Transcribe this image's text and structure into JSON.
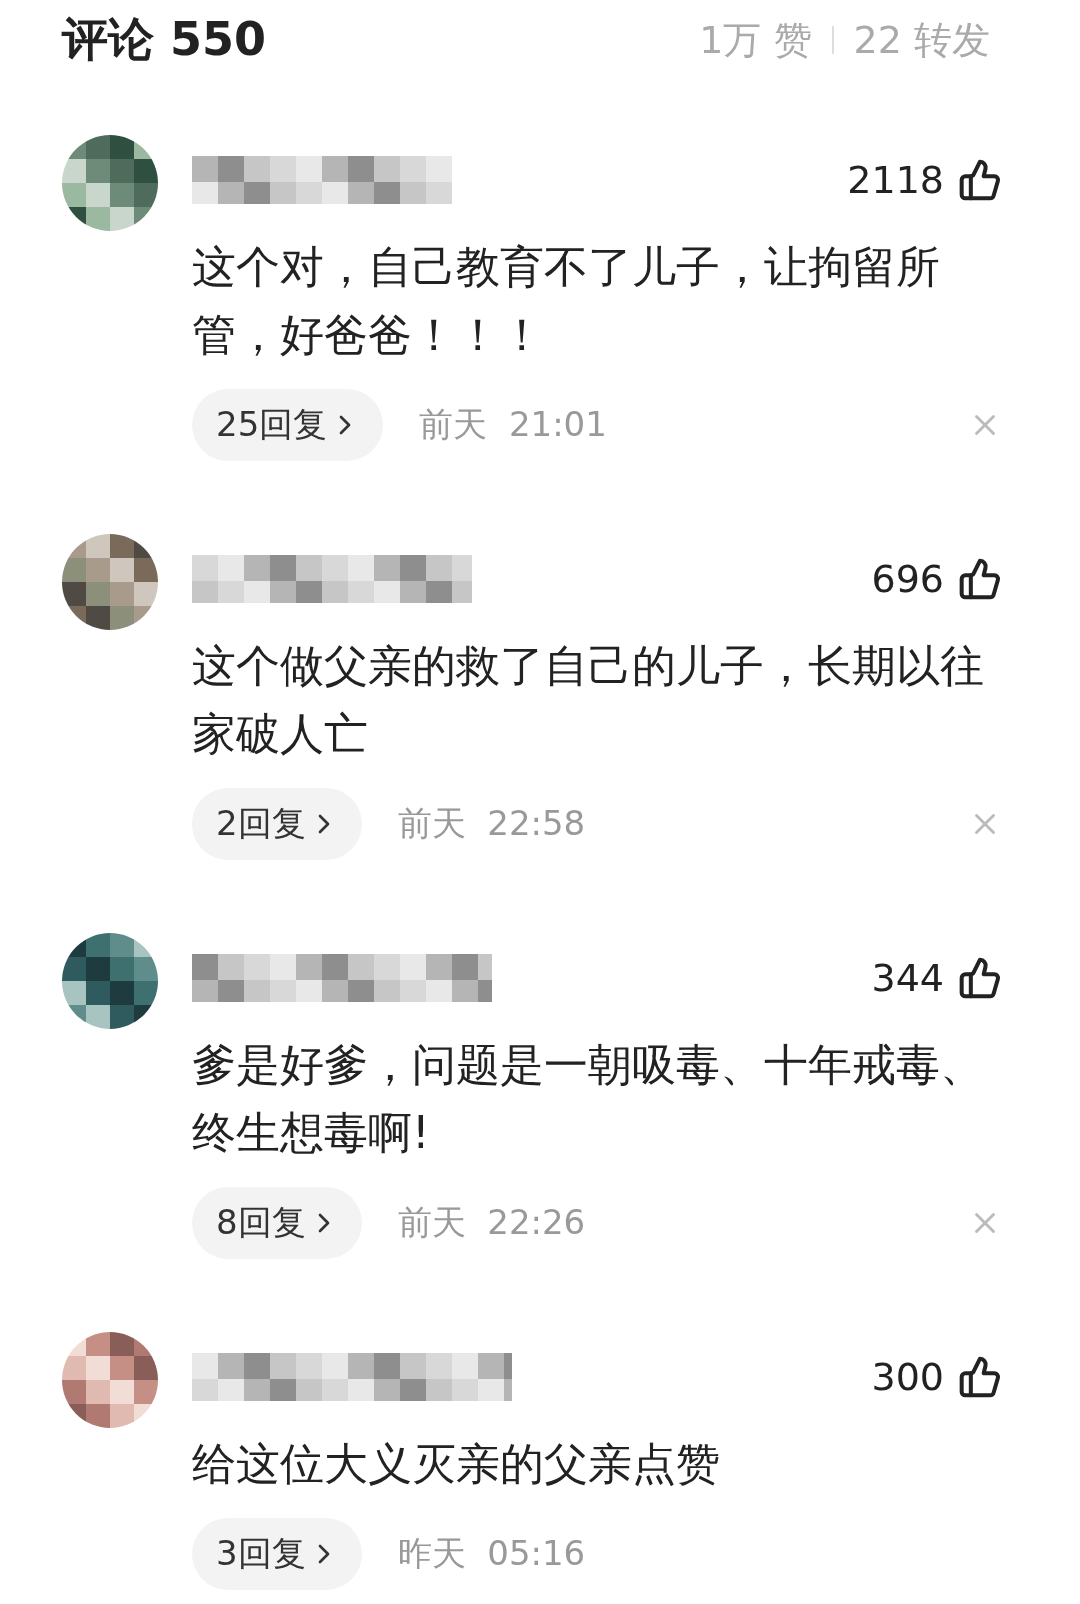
{
  "header": {
    "title": "评论 550",
    "likes": "1万 赞",
    "reposts": "22 转发"
  },
  "comments": [
    {
      "likes": "2118",
      "text": "这个对，自己教育不了儿子，让拘留所管，好爸爸！！！",
      "replies": "25回复",
      "time": "前天  21:01",
      "dismiss": true
    },
    {
      "likes": "696",
      "text": "这个做父亲的救了自己的儿子，长期以往家破人亡",
      "replies": "2回复",
      "time": "前天  22:58",
      "dismiss": true
    },
    {
      "likes": "344",
      "text": "爹是好爹，问题是一朝吸毒、十年戒毒、终生想毒啊!",
      "replies": "8回复",
      "time": "前天  22:26",
      "dismiss": true
    },
    {
      "likes": "300",
      "text": "给这位大义灭亲的父亲点赞",
      "replies": "3回复",
      "time": "昨天  05:16",
      "dismiss": false
    }
  ]
}
